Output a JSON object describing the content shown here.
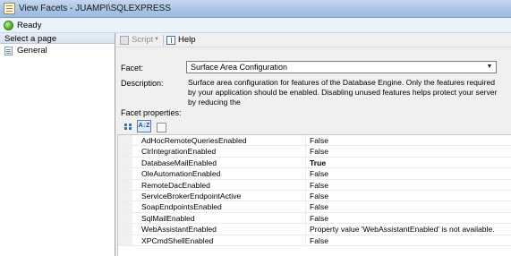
{
  "window": {
    "title": "View Facets - JUAMPI\\SQLEXPRESS",
    "icon": "facets-window-icon"
  },
  "status": {
    "text": "Ready",
    "icon": "ready-icon",
    "color": "#3ea515"
  },
  "left_panel": {
    "header": "Select a page",
    "items": [
      {
        "label": "General",
        "icon": "page-icon"
      }
    ]
  },
  "toolbar": {
    "script_label": "Script",
    "help_label": "Help"
  },
  "form": {
    "facet_label": "Facet:",
    "facet_value": "Surface Area Configuration",
    "description_label": "Description:",
    "description_text": "Surface area configuration for features of the Database Engine. Only the features required by your application should be enabled. Disabling unused features helps protect your server by reducing the",
    "facet_properties_label": "Facet properties:"
  },
  "properties_toolbar": {
    "buttons": [
      {
        "icon": "categorized-icon",
        "active": false
      },
      {
        "icon": "alphabetical-sort-icon",
        "active": true
      },
      {
        "icon": "property-pages-icon",
        "active": false
      }
    ]
  },
  "properties": [
    {
      "name": "AdHocRemoteQueriesEnabled",
      "value": "False",
      "bold": false
    },
    {
      "name": "ClrIntegrationEnabled",
      "value": "False",
      "bold": false
    },
    {
      "name": "DatabaseMailEnabled",
      "value": "True",
      "bold": true
    },
    {
      "name": "OleAutomationEnabled",
      "value": "False",
      "bold": false
    },
    {
      "name": "RemoteDacEnabled",
      "value": "False",
      "bold": false
    },
    {
      "name": "ServiceBrokerEndpointActive",
      "value": "False",
      "bold": false
    },
    {
      "name": "SoapEndpointsEnabled",
      "value": "False",
      "bold": false
    },
    {
      "name": "SqlMailEnabled",
      "value": "False",
      "bold": false
    },
    {
      "name": "WebAssistantEnabled",
      "value": "Property value 'WebAssistantEnabled' is not available.",
      "bold": false
    },
    {
      "name": "XPCmdShellEnabled",
      "value": "False",
      "bold": false
    }
  ]
}
